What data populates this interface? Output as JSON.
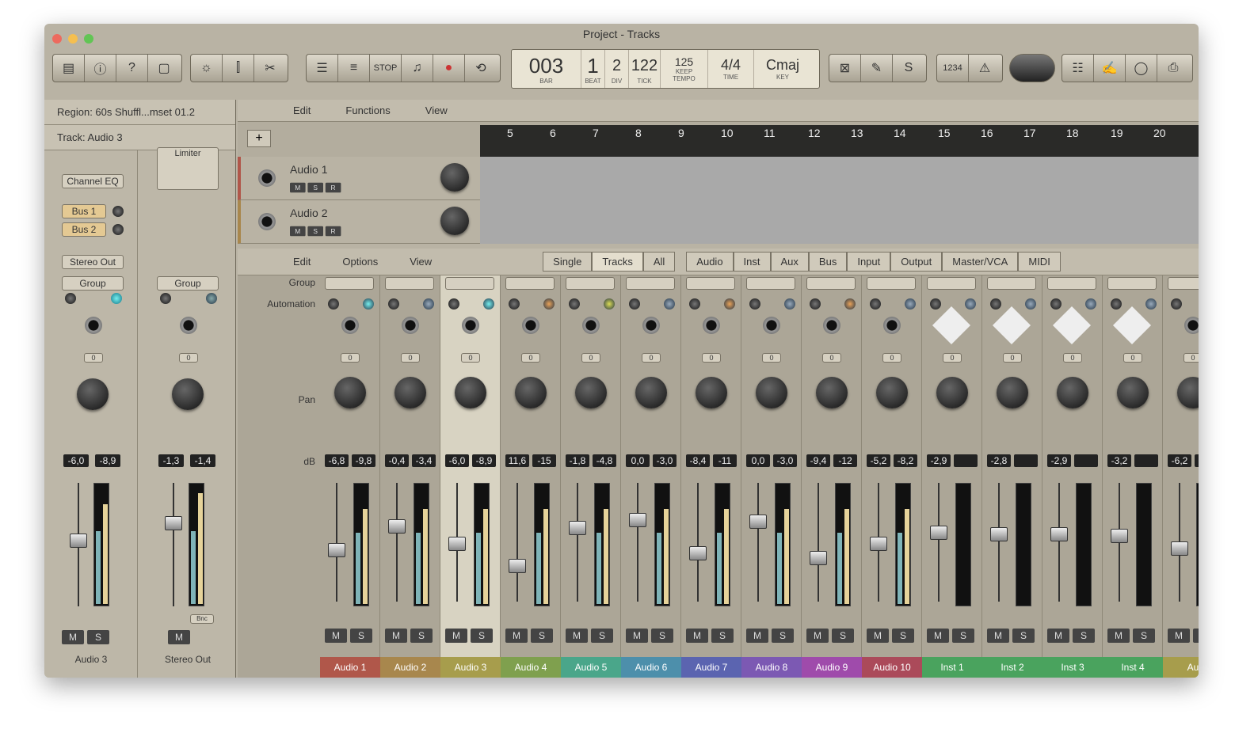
{
  "window": {
    "title": "Project - Tracks"
  },
  "lcd": {
    "bar": "003",
    "bar_label": "BAR",
    "beat": "1",
    "beat_label": "BEAT",
    "div": "2",
    "div_label": "DIV",
    "tick": "122",
    "tick_label": "TICK",
    "tempo": "125",
    "tempo_sub": "KEEP",
    "tempo_label": "TEMPO",
    "time": "4/4",
    "time_label": "TIME",
    "key": "Cmaj",
    "key_label": "KEY"
  },
  "toolbar": {
    "stop": "STOP",
    "count": "1234"
  },
  "inspector": {
    "region": "Region: 60s Shuffl...mset 01.2",
    "track": "Track: Audio 3",
    "channel_eq": "Channel EQ",
    "bus1": "Bus 1",
    "bus2": "Bus 2",
    "output": "Stereo Out",
    "group": "Group",
    "limiter": "Limiter",
    "strip1": {
      "name": "Audio 3",
      "db1": "-6,0",
      "db2": "-8,9",
      "pan": "0"
    },
    "strip2": {
      "name": "Stereo Out",
      "db1": "-1,3",
      "db2": "-1,4",
      "pan": "0",
      "bnc": "Bnc"
    }
  },
  "tracks_bar": {
    "edit": "Edit",
    "functions": "Functions",
    "view": "View"
  },
  "ruler": [
    "5",
    "6",
    "7",
    "8",
    "9",
    "10",
    "11",
    "12",
    "13",
    "14",
    "15",
    "16",
    "17",
    "18",
    "19",
    "20"
  ],
  "tracks": [
    {
      "name": "Audio 1"
    },
    {
      "name": "Audio 2"
    }
  ],
  "mixer_bar": {
    "edit": "Edit",
    "options": "Options",
    "view": "View",
    "single": "Single",
    "tracks": "Tracks",
    "all": "All",
    "audio": "Audio",
    "inst": "Inst",
    "aux": "Aux",
    "bus": "Bus",
    "input": "Input",
    "output": "Output",
    "master": "Master/VCA",
    "midi": "MIDI"
  },
  "mixer_labels": {
    "group": "Group",
    "automation": "Automation",
    "pan": "Pan",
    "db": "dB"
  },
  "channels": [
    {
      "name": "Audio 1",
      "db1": "-6,8",
      "db2": "-9,8",
      "color": "#b0574a"
    },
    {
      "name": "Audio 2",
      "db1": "-0,4",
      "db2": "-3,4",
      "color": "#a8874d"
    },
    {
      "name": "Audio 3",
      "db1": "-6,0",
      "db2": "-8,9",
      "color": "#a79d4c"
    },
    {
      "name": "Audio 4",
      "db1": "11,6",
      "db2": "-15",
      "color": "#7fa04e"
    },
    {
      "name": "Audio 5",
      "db1": "-1,8",
      "db2": "-4,8",
      "color": "#4aa68a"
    },
    {
      "name": "Audio 6",
      "db1": "0,0",
      "db2": "-3,0",
      "color": "#4d8fab"
    },
    {
      "name": "Audio 7",
      "db1": "-8,4",
      "db2": "-11",
      "color": "#5b64b0"
    },
    {
      "name": "Audio 8",
      "db1": "0,0",
      "db2": "-3,0",
      "color": "#7c59b3"
    },
    {
      "name": "Audio 9",
      "db1": "-9,4",
      "db2": "-12",
      "color": "#9f4bab"
    },
    {
      "name": "Audio 10",
      "db1": "-5,2",
      "db2": "-8,2",
      "color": "#ab4a5a"
    },
    {
      "name": "Inst 1",
      "db1": "-2,9",
      "db2": "",
      "color": "#4aa35e"
    },
    {
      "name": "Inst 2",
      "db1": "-2,8",
      "db2": "",
      "color": "#4aa35e"
    },
    {
      "name": "Inst 3",
      "db1": "-2,9",
      "db2": "",
      "color": "#4aa35e"
    },
    {
      "name": "Inst 4",
      "db1": "-3,2",
      "db2": "",
      "color": "#4aa35e"
    },
    {
      "name": "Au",
      "db1": "-6,2",
      "db2": "",
      "color": "#a79d4c"
    }
  ]
}
